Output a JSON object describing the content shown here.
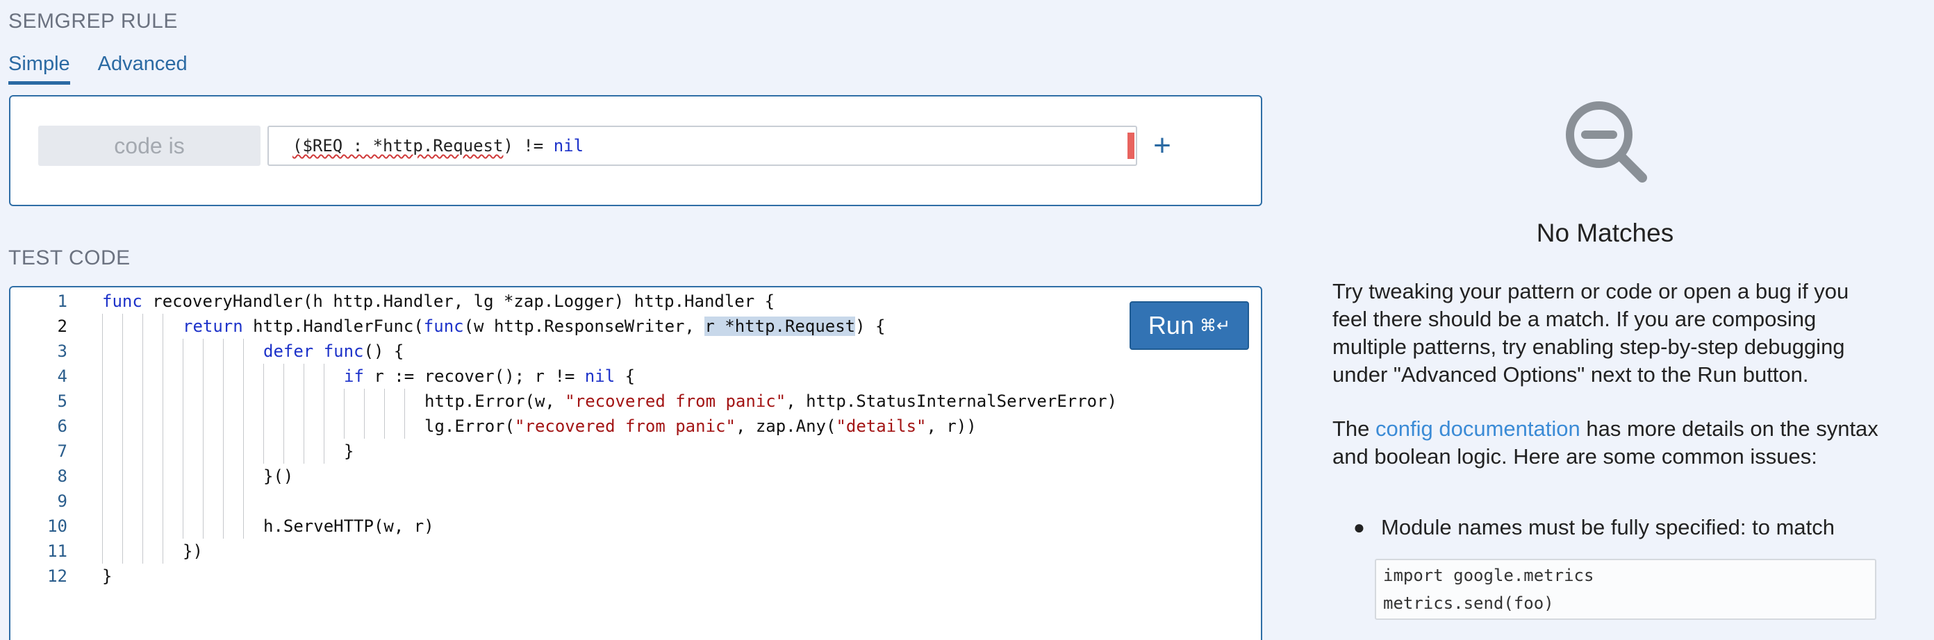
{
  "rule_section": {
    "title": "SEMGREP RULE"
  },
  "tabs": [
    {
      "label": "Simple",
      "active": true
    },
    {
      "label": "Advanced",
      "active": false
    }
  ],
  "pattern": {
    "operator_label": "code is",
    "value": "($REQ : *http.Request) != nil",
    "add_label": "+"
  },
  "test_section": {
    "title": "TEST CODE"
  },
  "run_button": {
    "label": "Run",
    "shortcut": "⌘↵"
  },
  "editor": {
    "current_line": 2,
    "lines": [
      "func recoveryHandler(h http.Handler, lg *zap.Logger) http.Handler {",
      "    return http.HandlerFunc(func(w http.ResponseWriter, r *http.Request) {",
      "        defer func() {",
      "            if r := recover(); r != nil {",
      "                http.Error(w, \"recovered from panic\", http.StatusInternalServerError)",
      "                lg.Error(\"recovered from panic\", zap.Any(\"details\", r))",
      "            }",
      "        }()",
      "",
      "        h.ServeHTTP(w, r)",
      "    })",
      "}"
    ],
    "highlight": {
      "line": 2,
      "text": "r *http.Request"
    }
  },
  "results": {
    "icon": "zoom-out-icon",
    "heading": "No Matches",
    "para1": "Try tweaking your pattern or code or open a bug if you feel there should be a match. If you are composing multiple patterns, try enabling step-by-step debugging under \"Advanced Options\" next to the Run button.",
    "para2_before": "The ",
    "para2_link": "config documentation",
    "para2_after": " has more details on the syntax and boolean logic. Here are some common issues:",
    "bullet": "Module names must be fully specified: to match",
    "code_example": "import google.metrics\nmetrics.send(foo)"
  },
  "colors": {
    "accent": "#2b6aa3",
    "background": "#eff3fb",
    "keyword": "#1d32c9",
    "string": "#a31515",
    "link": "#3b8bd6",
    "error": "#e8645f"
  }
}
